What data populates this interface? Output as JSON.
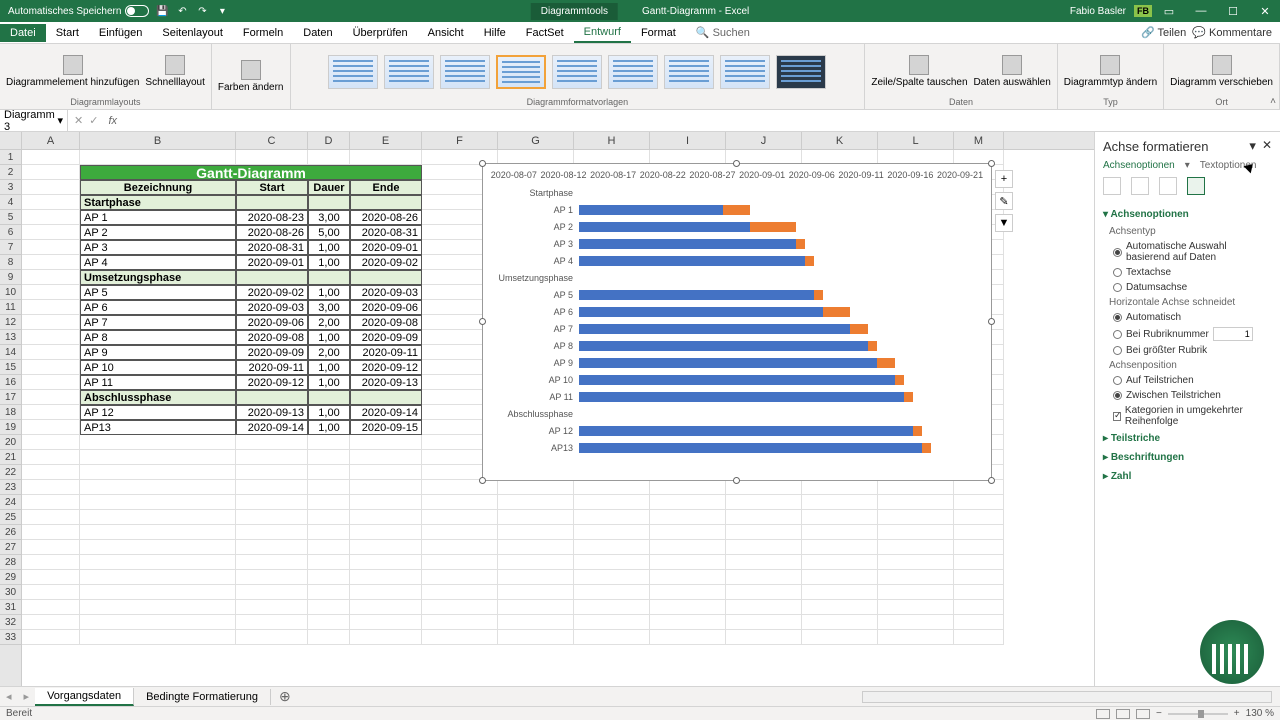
{
  "titlebar": {
    "autosave": "Automatisches Speichern",
    "tools_tab": "Diagrammtools",
    "doc_title": "Gantt-Diagramm - Excel",
    "user": "Fabio Basler",
    "user_initials": "FB"
  },
  "ribbon_tabs": {
    "file": "Datei",
    "home": "Start",
    "insert": "Einfügen",
    "pagelayout": "Seitenlayout",
    "formulas": "Formeln",
    "data": "Daten",
    "review": "Überprüfen",
    "view": "Ansicht",
    "help": "Hilfe",
    "factset": "FactSet",
    "design": "Entwurf",
    "format": "Format",
    "search": "Suchen",
    "share": "Teilen",
    "comments": "Kommentare"
  },
  "ribbon": {
    "add_element": "Diagrammelement hinzufügen",
    "quick_layout": "Schnelllayout",
    "colors": "Farben ändern",
    "group_layouts": "Diagrammlayouts",
    "group_styles": "Diagrammformatvorlagen",
    "switch_rc": "Zeile/Spalte tauschen",
    "select_data": "Daten auswählen",
    "group_data": "Daten",
    "change_type": "Diagrammtyp ändern",
    "group_type": "Typ",
    "move_chart": "Diagramm verschieben",
    "group_location": "Ort"
  },
  "name_box": "Diagramm 3",
  "columns": [
    "A",
    "B",
    "C",
    "D",
    "E",
    "F",
    "G",
    "H",
    "I",
    "J",
    "K",
    "L",
    "M"
  ],
  "table": {
    "title": "Gantt-Diagramm",
    "headers": {
      "b": "Bezeichnung",
      "c": "Start",
      "d": "Dauer",
      "e": "Ende"
    },
    "rows": [
      {
        "type": "phase",
        "b": "Startphase"
      },
      {
        "type": "task",
        "b": "AP 1",
        "c": "2020-08-23",
        "d": "3,00",
        "e": "2020-08-26"
      },
      {
        "type": "task",
        "b": "AP 2",
        "c": "2020-08-26",
        "d": "5,00",
        "e": "2020-08-31"
      },
      {
        "type": "task",
        "b": "AP 3",
        "c": "2020-08-31",
        "d": "1,00",
        "e": "2020-09-01"
      },
      {
        "type": "task",
        "b": "AP 4",
        "c": "2020-09-01",
        "d": "1,00",
        "e": "2020-09-02"
      },
      {
        "type": "phase",
        "b": "Umsetzungsphase"
      },
      {
        "type": "task",
        "b": "AP 5",
        "c": "2020-09-02",
        "d": "1,00",
        "e": "2020-09-03"
      },
      {
        "type": "task",
        "b": "AP 6",
        "c": "2020-09-03",
        "d": "3,00",
        "e": "2020-09-06"
      },
      {
        "type": "task",
        "b": "AP 7",
        "c": "2020-09-06",
        "d": "2,00",
        "e": "2020-09-08"
      },
      {
        "type": "task",
        "b": "AP 8",
        "c": "2020-09-08",
        "d": "1,00",
        "e": "2020-09-09"
      },
      {
        "type": "task",
        "b": "AP 9",
        "c": "2020-09-09",
        "d": "2,00",
        "e": "2020-09-11"
      },
      {
        "type": "task",
        "b": "AP 10",
        "c": "2020-09-11",
        "d": "1,00",
        "e": "2020-09-12"
      },
      {
        "type": "task",
        "b": "AP 11",
        "c": "2020-09-12",
        "d": "1,00",
        "e": "2020-09-13"
      },
      {
        "type": "phase",
        "b": "Abschlussphase"
      },
      {
        "type": "task",
        "b": "AP 12",
        "c": "2020-09-13",
        "d": "1,00",
        "e": "2020-09-14"
      },
      {
        "type": "task",
        "b": "AP13",
        "c": "2020-09-14",
        "d": "1,00",
        "e": "2020-09-15"
      }
    ]
  },
  "chart_data": {
    "type": "bar",
    "orientation": "horizontal",
    "stacked": true,
    "title": "",
    "x_ticks": [
      "2020-08-07",
      "2020-08-12",
      "2020-08-17",
      "2020-08-22",
      "2020-08-27",
      "2020-09-01",
      "2020-09-06",
      "2020-09-11",
      "2020-09-16",
      "2020-09-21"
    ],
    "x_range_days": 45,
    "x_origin": "2020-08-07",
    "categories": [
      "Startphase",
      "AP 1",
      "AP 2",
      "AP 3",
      "AP 4",
      "Umsetzungsphase",
      "AP 5",
      "AP 6",
      "AP 7",
      "AP 8",
      "AP 9",
      "AP 10",
      "AP 11",
      "Abschlussphase",
      "AP 12",
      "AP13"
    ],
    "series": [
      {
        "name": "Start (offset days from 2020-08-07)",
        "color": "#4472c4",
        "values": [
          0,
          16,
          19,
          24,
          25,
          0,
          26,
          27,
          30,
          32,
          33,
          35,
          36,
          0,
          37,
          38
        ]
      },
      {
        "name": "Dauer",
        "color": "#ed7d31",
        "values": [
          0,
          3,
          5,
          1,
          1,
          0,
          1,
          3,
          2,
          1,
          2,
          1,
          1,
          0,
          1,
          1
        ]
      }
    ]
  },
  "format_pane": {
    "title": "Achse formatieren",
    "tab_axis": "Achsenoptionen",
    "tab_text": "Textoptionen",
    "sec_options": "Achsenoptionen",
    "axis_type": "Achsentyp",
    "opt_auto": "Automatische Auswahl basierend auf Daten",
    "opt_text": "Textachse",
    "opt_date": "Datumsachse",
    "h_axis_crosses": "Horizontale Achse schneidet",
    "opt_auto2": "Automatisch",
    "opt_at_cat": "Bei Rubriknummer",
    "opt_at_cat_val": "1",
    "opt_max_cat": "Bei größter Rubrik",
    "axis_pos": "Achsenposition",
    "opt_on_tick": "Auf Teilstrichen",
    "opt_between": "Zwischen Teilstrichen",
    "opt_reverse": "Kategorien in umgekehrter Reihenfolge",
    "sec_ticks": "Teilstriche",
    "sec_labels": "Beschriftungen",
    "sec_number": "Zahl"
  },
  "sheets": {
    "s1": "Vorgangsdaten",
    "s2": "Bedingte Formatierung"
  },
  "status": {
    "ready": "Bereit",
    "zoom": "130 %"
  }
}
